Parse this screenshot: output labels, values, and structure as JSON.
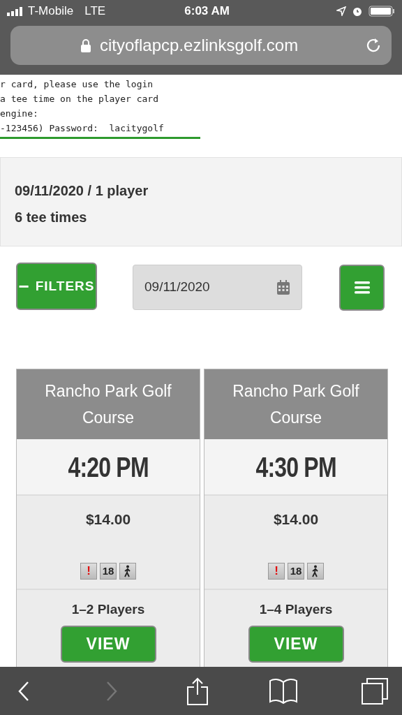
{
  "status_bar": {
    "carrier": "T-Mobile",
    "network": "LTE",
    "time": "6:03 AM"
  },
  "url_bar": {
    "url": "cityoflapcp.ezlinksgolf.com"
  },
  "notice_lines": [
    "r card, please use the login",
    "a tee time on the player card",
    "engine:",
    "-123456) Password:  lacitygolf"
  ],
  "summary": {
    "line_1": "09/11/2020 / 1 player",
    "line_2": "6 tee times"
  },
  "filters_button": {
    "icon": "−",
    "label": "FILTERS"
  },
  "date_field": {
    "value": "09/11/2020"
  },
  "tee_times": [
    {
      "course": "Rancho Park Golf Course",
      "time": "4:20 PM",
      "price": "$14.00",
      "badges": [
        {
          "kind": "alert",
          "text": "!"
        },
        {
          "kind": "holes",
          "text": "18"
        },
        {
          "kind": "walk"
        }
      ],
      "players": "1–2 Players",
      "button": "VIEW"
    },
    {
      "course": "Rancho Park Golf Course",
      "time": "4:30 PM",
      "price": "$14.00",
      "badges": [
        {
          "kind": "alert",
          "text": "!"
        },
        {
          "kind": "holes",
          "text": "18"
        },
        {
          "kind": "walk"
        }
      ],
      "players": "1–4 Players",
      "button": "VIEW"
    }
  ],
  "toolbar": {
    "back_disabled": false,
    "forward_disabled": true
  }
}
